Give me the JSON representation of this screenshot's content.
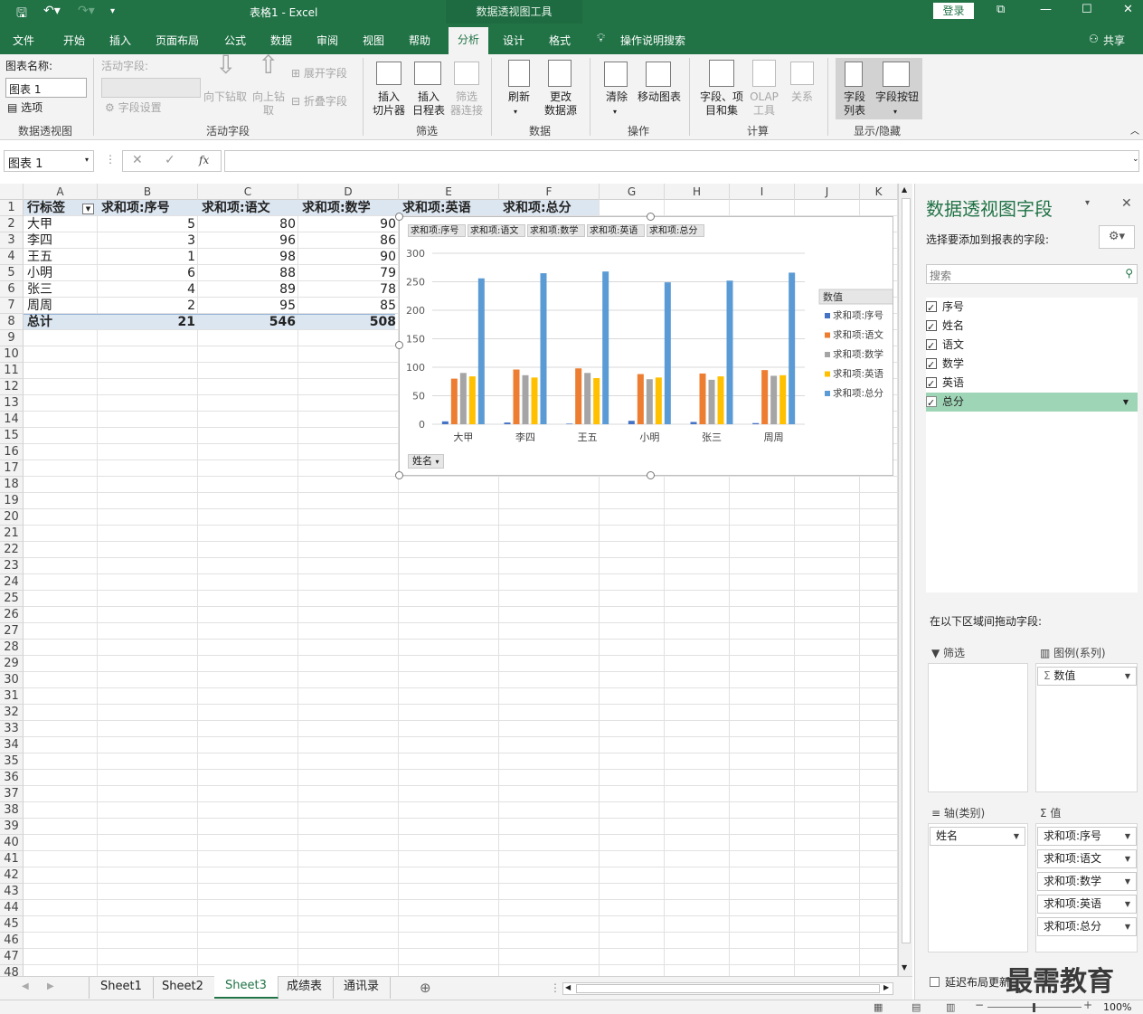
{
  "title_bar": {
    "doc_title": "表格1  -  Excel",
    "context_tools": "数据透视图工具",
    "login": "登录"
  },
  "tabs": [
    "文件",
    "开始",
    "插入",
    "页面布局",
    "公式",
    "数据",
    "审阅",
    "视图",
    "帮助",
    "分析",
    "设计",
    "格式"
  ],
  "active_tab": "分析",
  "tell_me": "操作说明搜索",
  "share": "共享",
  "ribbon": {
    "chart_name_label": "图表名称:",
    "chart_name_value": "图表 1",
    "options": "选项",
    "group_pivotchart": "数据透视图",
    "active_field_label": "活动字段:",
    "field_settings": "字段设置",
    "drill_down": "向下钻取",
    "drill_up": "向上钻\n取",
    "expand_field": "展开字段",
    "collapse_field": "折叠字段",
    "group_active_field": "活动字段",
    "insert_slicer": "插入\n切片器",
    "insert_timeline": "插入\n日程表",
    "filter_connections": "筛选\n器连接",
    "group_filter": "筛选",
    "refresh": "刷新",
    "change_source": "更改\n数据源",
    "group_data": "数据",
    "clear": "清除",
    "move_chart": "移动图表",
    "group_actions": "操作",
    "fields_items": "字段、项\n目和集",
    "olap_tools": "OLAP\n工具",
    "relationships": "关系",
    "group_calc": "计算",
    "field_list": "字段\n列表",
    "field_buttons": "字段按钮",
    "group_show_hide": "显示/隐藏"
  },
  "formula_bar": {
    "name_box": "图表 1",
    "fx": "fx",
    "content": ""
  },
  "columns": [
    "A",
    "B",
    "C",
    "D",
    "E",
    "F",
    "G",
    "H",
    "I",
    "J",
    "K"
  ],
  "rows": [
    "1",
    "2",
    "3",
    "4",
    "5",
    "6",
    "7",
    "8",
    "9",
    "10",
    "11",
    "12",
    "13",
    "14",
    "15",
    "16",
    "17",
    "18",
    "19",
    "20",
    "21",
    "22",
    "23",
    "24",
    "25",
    "26",
    "27",
    "28",
    "29",
    "30",
    "31",
    "32",
    "33",
    "34",
    "35",
    "36",
    "37",
    "38",
    "39",
    "40",
    "41",
    "42",
    "43",
    "44",
    "45",
    "46",
    "47",
    "48"
  ],
  "pivot_table": {
    "headers": [
      "行标签",
      "求和项:序号",
      "求和项:语文",
      "求和项:数学",
      "求和项:英语",
      "求和项:总分"
    ],
    "rows": [
      {
        "name": "大甲",
        "vals": [
          "5",
          "80",
          "90"
        ]
      },
      {
        "name": "李四",
        "vals": [
          "3",
          "96",
          "86"
        ]
      },
      {
        "name": "王五",
        "vals": [
          "1",
          "98",
          "90"
        ]
      },
      {
        "name": "小明",
        "vals": [
          "6",
          "88",
          "79"
        ]
      },
      {
        "name": "张三",
        "vals": [
          "4",
          "89",
          "78"
        ]
      },
      {
        "name": "周周",
        "vals": [
          "2",
          "95",
          "85"
        ]
      }
    ],
    "total": {
      "name": "总计",
      "vals": [
        "21",
        "546",
        "508"
      ]
    }
  },
  "chart_data": {
    "type": "bar",
    "categories": [
      "大甲",
      "李四",
      "王五",
      "小明",
      "张三",
      "周周"
    ],
    "series": [
      {
        "name": "求和项:序号",
        "values": [
          5,
          3,
          1,
          6,
          4,
          2
        ],
        "color": "#4472c4"
      },
      {
        "name": "求和项:语文",
        "values": [
          80,
          96,
          98,
          88,
          89,
          95
        ],
        "color": "#ed7d31"
      },
      {
        "name": "求和项:数学",
        "values": [
          90,
          86,
          90,
          79,
          78,
          85
        ],
        "color": "#a5a5a5"
      },
      {
        "name": "求和项:英语",
        "values": [
          84,
          82,
          81,
          82,
          84,
          86
        ],
        "color": "#ffc000"
      },
      {
        "name": "求和项:总分",
        "values": [
          256,
          265,
          268,
          249,
          252,
          266
        ],
        "color": "#5b9bd5"
      }
    ],
    "ylim": [
      0,
      300
    ],
    "yticks": [
      0,
      50,
      100,
      150,
      200,
      250,
      300
    ],
    "legend_title": "数值",
    "legend_position": "right",
    "axis_field_button": "姓名",
    "grid": true
  },
  "sheets": [
    "Sheet1",
    "Sheet2",
    "Sheet3",
    "成绩表",
    "通讯录"
  ],
  "active_sheet": "Sheet3",
  "pane": {
    "title": "数据透视图字段",
    "subtitle": "选择要添加到报表的字段:",
    "search_placeholder": "搜索",
    "fields": [
      "序号",
      "姓名",
      "语文",
      "数学",
      "英语",
      "总分"
    ],
    "drag_label": "在以下区域间拖动字段:",
    "filter_area": "筛选",
    "legend_area": "图例(系列)",
    "legend_items": [
      "数值"
    ],
    "axis_area": "轴(类别)",
    "axis_items": [
      "姓名"
    ],
    "values_area": "值",
    "values_items": [
      "求和项:序号",
      "求和项:语文",
      "求和项:数学",
      "求和项:英语",
      "求和项:总分"
    ],
    "defer_update": "延迟布局更新"
  },
  "zoom": "100%",
  "watermark": "最需教育"
}
